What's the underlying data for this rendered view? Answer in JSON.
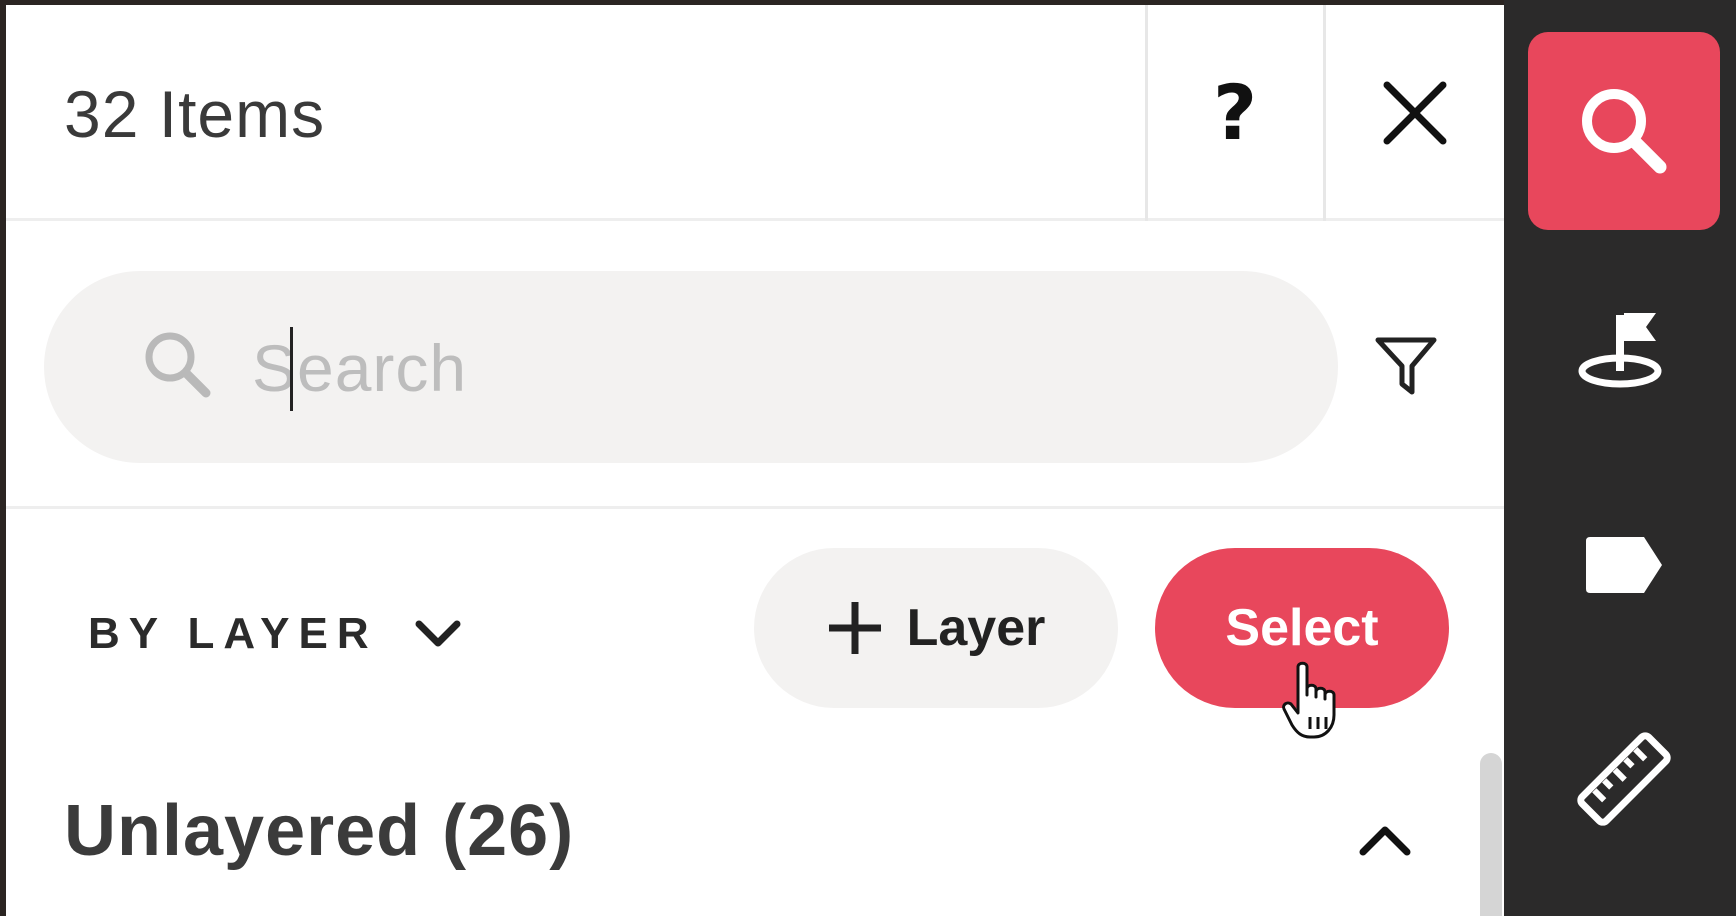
{
  "header": {
    "title": "32 Items",
    "help_label": "?",
    "close_label": "close"
  },
  "search": {
    "placeholder": "Search",
    "value": ""
  },
  "controls": {
    "group_by_label": "BY LAYER",
    "add_layer_label": "Layer",
    "select_label": "Select"
  },
  "group": {
    "title": "Unlayered (26)"
  },
  "rail": {
    "items": [
      {
        "name": "search",
        "icon": "search-icon",
        "active": true
      },
      {
        "name": "location",
        "icon": "location-flag-icon",
        "active": false
      },
      {
        "name": "tag",
        "icon": "tag-icon",
        "active": false
      },
      {
        "name": "measure",
        "icon": "ruler-icon",
        "active": false
      }
    ]
  },
  "colors": {
    "accent": "#e8475c",
    "rail_bg": "#2b2a2a",
    "panel_bg": "#ffffff",
    "search_bg": "#f3f2f1"
  }
}
